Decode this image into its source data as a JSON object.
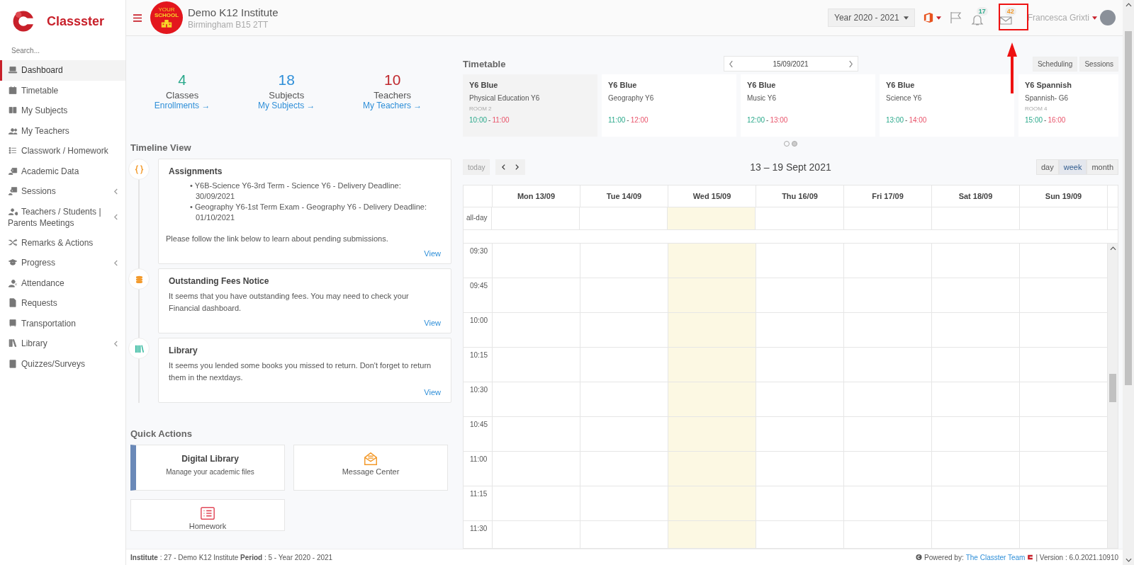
{
  "brand": {
    "name": "Classster"
  },
  "sidebar": {
    "search": {
      "placeholder": "Search..."
    },
    "items": [
      {
        "label": "Dashboard",
        "selected": true,
        "expandable": false
      },
      {
        "label": "Timetable",
        "selected": false,
        "expandable": false
      },
      {
        "label": "My Subjects",
        "selected": false,
        "expandable": false
      },
      {
        "label": "My Teachers",
        "selected": false,
        "expandable": false
      },
      {
        "label": "Classwork / Homework",
        "selected": false,
        "expandable": false
      },
      {
        "label": "Academic Data",
        "selected": false,
        "expandable": false
      },
      {
        "label": "Sessions",
        "selected": false,
        "expandable": true
      },
      {
        "label": "Teachers / Students | Parents Meetings",
        "selected": false,
        "expandable": true
      },
      {
        "label": "Remarks & Actions",
        "selected": false,
        "expandable": false
      },
      {
        "label": "Progress",
        "selected": false,
        "expandable": true
      },
      {
        "label": "Attendance",
        "selected": false,
        "expandable": false
      },
      {
        "label": "Requests",
        "selected": false,
        "expandable": false
      },
      {
        "label": "Transportation",
        "selected": false,
        "expandable": false
      },
      {
        "label": "Library",
        "selected": false,
        "expandable": true
      },
      {
        "label": "Quizzes/Surveys",
        "selected": false,
        "expandable": false
      }
    ]
  },
  "header": {
    "school": {
      "logo_text": [
        "YOUR",
        "SCHOOL"
      ],
      "name": "Demo K12 Institute",
      "address": "Birmingham B15 2TT"
    },
    "year_selector": "Year 2020 - 2021",
    "notifications_count": "17",
    "messages_count": "42",
    "user_name": "Francesca Grixti"
  },
  "stats": [
    {
      "value": "4",
      "label": "Classes",
      "link": "Enrollments →",
      "color": "#2aa98b"
    },
    {
      "value": "18",
      "label": "Subjects",
      "link": "My Subjects →",
      "color": "#2f8fd8"
    },
    {
      "value": "10",
      "label": "Teachers",
      "link": "My Teachers →",
      "color": "#c0282d"
    }
  ],
  "timeline": {
    "title": "Timeline View",
    "entries": [
      {
        "kind": "assignments",
        "title": "Assignments",
        "items": [
          "• Y6B-Science Y6-3rd Term - Science Y6 - Delivery Deadline: 30/09/2021",
          "• Geography Y6-1st Term Exam - Geography Y6 - Delivery Deadline: 01/10/2021"
        ],
        "text": "Please follow the link below to learn about pending submissions.",
        "link": "View"
      },
      {
        "kind": "fees",
        "title": "Outstanding Fees Notice",
        "text": "It seems that you have outstanding fees. You may need to check your Financial dashboard.",
        "link": "View"
      },
      {
        "kind": "library",
        "title": "Library",
        "text": "It seems you lended some books you missed to return. Don't forget to return them in the nextdays.",
        "link": "View"
      }
    ]
  },
  "quick_actions": {
    "title": "Quick Actions",
    "cards": [
      {
        "kind": "featured",
        "title": "Digital Library",
        "subtitle": "Manage your academic files"
      },
      {
        "kind": "mail",
        "title": "Message Center"
      },
      {
        "kind": "list",
        "title": "Homework"
      }
    ]
  },
  "timetable": {
    "title": "Timetable",
    "date": "15/09/2021",
    "buttons": [
      "Scheduling",
      "Sessions"
    ],
    "lessons": [
      {
        "group": "Y6 Blue",
        "subject": "Physical Education Y6",
        "room": "ROOM 2",
        "start": "10:00",
        "separator": "-",
        "end": "11:00",
        "selected": true
      },
      {
        "group": "Y6 Blue",
        "subject": "Geography Y6",
        "start": "11:00",
        "separator": "-",
        "end": "12:00",
        "selected": false
      },
      {
        "group": "Y6 Blue",
        "subject": "Music Y6",
        "start": "12:00",
        "separator": "-",
        "end": "13:00",
        "selected": false
      },
      {
        "group": "Y6 Blue",
        "subject": "Science Y6",
        "start": "13:00",
        "separator": "-",
        "end": "14:00",
        "selected": false
      },
      {
        "group": "Y6 Spannish",
        "subject": "Spannish- G6",
        "room": "ROOM 4",
        "start": "15:00",
        "separator": "-",
        "end": "16:00",
        "selected": false
      }
    ],
    "pages": [
      {
        "selected": false
      },
      {
        "selected": true
      }
    ]
  },
  "calendar": {
    "today_button": {
      "label": "today",
      "disabled": true
    },
    "title": "13 – 19 Sept 2021",
    "views": [
      {
        "label": "day",
        "selected": false
      },
      {
        "label": "week",
        "selected": true
      },
      {
        "label": "month",
        "selected": false
      }
    ],
    "all_day_label": "all-day",
    "days": [
      {
        "label": "Mon 13/09",
        "today": false
      },
      {
        "label": "Tue 14/09",
        "today": false
      },
      {
        "label": "Wed 15/09",
        "today": true
      },
      {
        "label": "Thu 16/09",
        "today": false
      },
      {
        "label": "Fri 17/09",
        "today": false
      },
      {
        "label": "Sat 18/09",
        "today": false
      },
      {
        "label": "Sun 19/09",
        "today": false
      }
    ],
    "times": [
      "09:30",
      "09:45",
      "10:00",
      "10:15",
      "10:30",
      "10:45",
      "11:00",
      "11:15",
      "11:30"
    ]
  },
  "footer": {
    "info": "**Institute** : 27 - Demo K12 Institute **Period** : 5 - Year 2020 - 2021",
    "powered_by": "Powered by:",
    "team_link": "The Classter Team",
    "version": "| Version : 6.0.2021.10910"
  }
}
